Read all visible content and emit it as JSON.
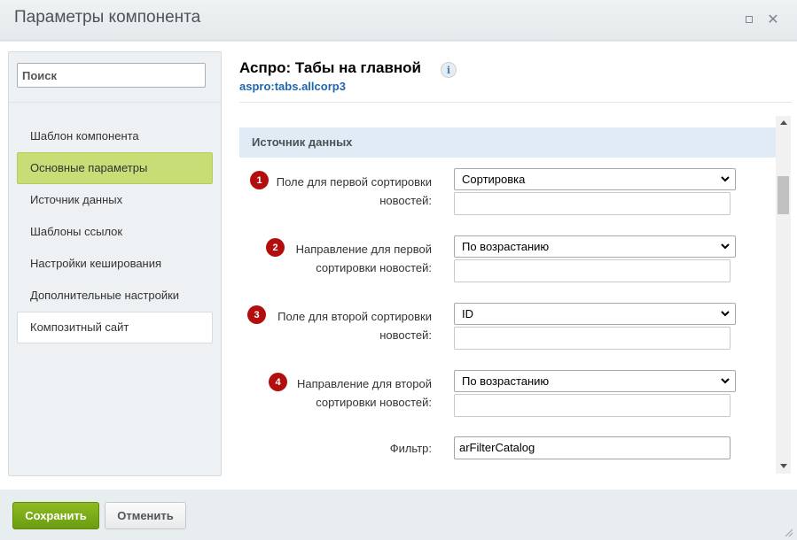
{
  "window": {
    "title": "Параметры компонента"
  },
  "sidebar": {
    "search_placeholder": "Поиск",
    "items": [
      {
        "label": "Шаблон компонента"
      },
      {
        "label": "Основные параметры"
      },
      {
        "label": "Источник данных"
      },
      {
        "label": "Шаблоны ссылок"
      },
      {
        "label": "Настройки кеширования"
      },
      {
        "label": "Дополнительные настройки"
      },
      {
        "label": "Композитный сайт"
      }
    ],
    "active_item": "Основные параметры"
  },
  "component": {
    "title": "Аспро: Табы на главной",
    "code": "aspro:tabs.allcorp3",
    "info_icon": "i"
  },
  "section": {
    "title": "Источник данных"
  },
  "fields": [
    {
      "badge": "1",
      "label_line1": "Поле для первой сортировки",
      "label_line2": "новостей:",
      "select_value": "Сортировка",
      "text_value": ""
    },
    {
      "badge": "2",
      "label_line1": "Направление для первой",
      "label_line2": "сортировки новостей:",
      "select_value": "По возрастанию",
      "text_value": ""
    },
    {
      "badge": "3",
      "label_line1": "Поле для второй сортировки",
      "label_line2": "новостей:",
      "select_value": "ID",
      "text_value": ""
    },
    {
      "badge": "4",
      "label_line1": "Направление для второй",
      "label_line2": "сортировки новостей:",
      "select_value": "По возрастанию",
      "text_value": ""
    }
  ],
  "filter": {
    "label": "Фильтр:",
    "value": "arFilterCatalog"
  },
  "footer": {
    "save_label": "Сохранить",
    "cancel_label": "Отменить"
  },
  "colors": {
    "active_nav": "#c7dd76",
    "badge": "#b30e0e",
    "save_button": "#7aab18",
    "section_header": "#e0ebf5",
    "link": "#2067b0"
  }
}
